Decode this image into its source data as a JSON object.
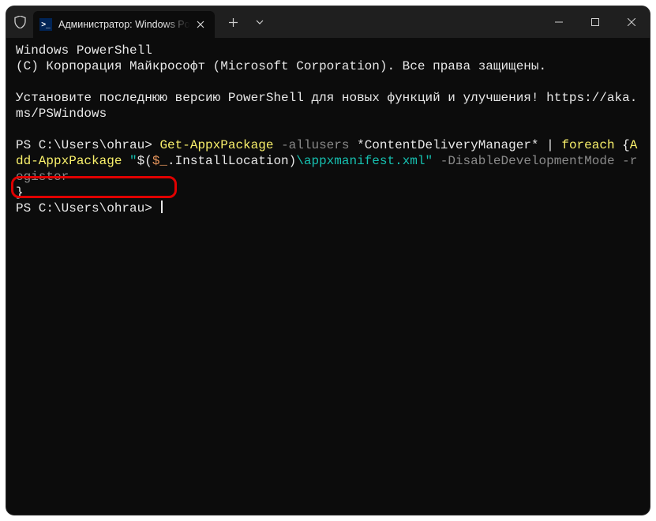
{
  "tab": {
    "title": "Администратор: Windows PowerShell",
    "icon_glyph": ">_"
  },
  "terminal": {
    "l1": "Windows PowerShell",
    "l2": "(C) Корпорация Майкрософт (Microsoft Corporation). Все права защищены.",
    "l3a": "Установите последнюю версию PowerShell для новых функций и улучшения! ",
    "l3b": "https://aka.ms/PSWindows",
    "prompt1": "PS C:\\Users\\ohrau> ",
    "cmd_get": "Get-AppxPackage",
    "cmd_flag1": " -allusers ",
    "cmd_pat": "*ContentDeliveryManager*",
    "cmd_pipe": " | ",
    "cmd_foreach": "foreach",
    "cmd_brace_open": " {",
    "cmd_add": "Add-AppxPackage",
    "cmd_q1": " \"",
    "cmd_subopen": "$(",
    "cmd_var": "$_",
    "cmd_dot": ".InstallLocation",
    "cmd_subclose": ")",
    "cmd_path": "\\appxmanifest.xml",
    "cmd_q2": "\"",
    "cmd_flag2": " -DisableDevelopmentMode -register",
    "cmd_brace_close": "}",
    "prompt2": "PS C:\\Users\\ohrau> "
  }
}
